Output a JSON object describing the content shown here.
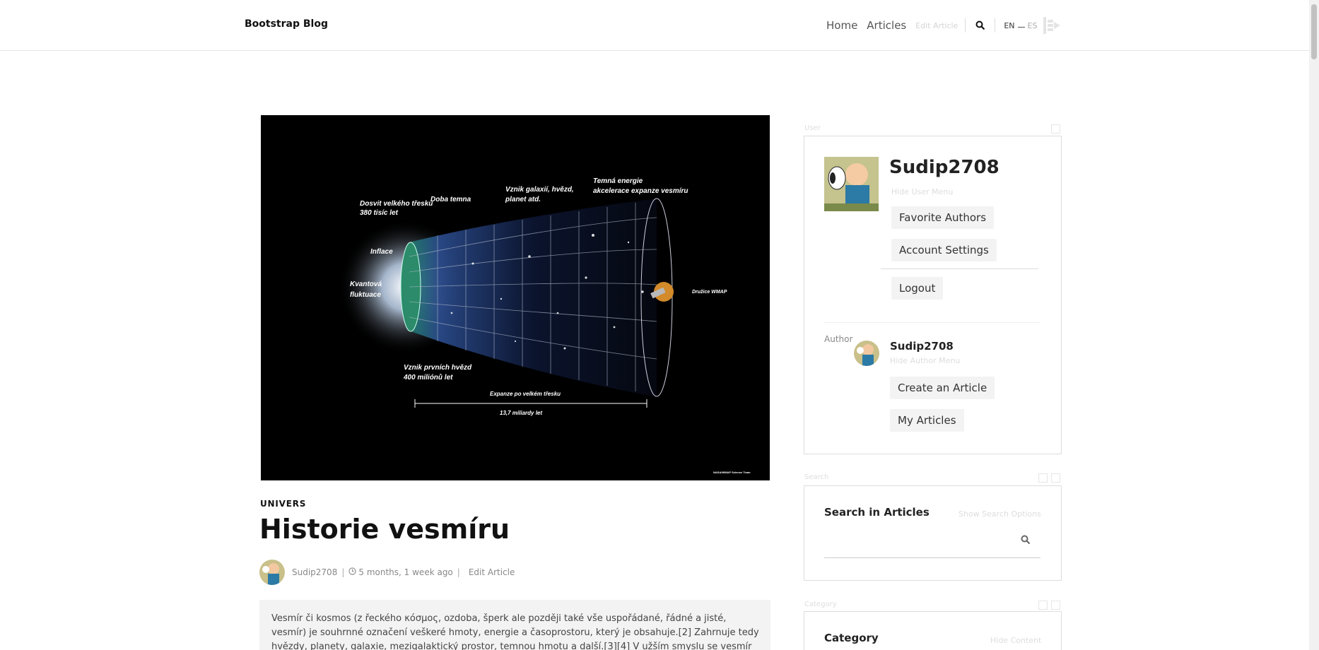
{
  "header": {
    "brand": "Bootstrap Blog",
    "nav": [
      {
        "label": "Home"
      },
      {
        "label": "Articles"
      }
    ],
    "edit_article_ghost": "Edit Article",
    "lang_en": "EN",
    "lang_es": "ES"
  },
  "article": {
    "category": "UNIVERS",
    "title": "Historie vesmíru",
    "author": "Sudip2708",
    "date_ago": "5 months, 1 week ago",
    "edit_link": "Edit Article",
    "excerpt": "Vesmír či kosmos (z řeckého κόσμος, ozdoba, šperk ale později také vše uspořádané, řádné a jisté, vesmír) je souhrnné označení veškeré hmoty, energie a časoprostoru, který je obsahuje.[2] Zahrnuje tedy hvězdy, planety, galaxie, mezigalaktický prostor, temnou hmotu a další.[3][4] V užším smyslu se vesmír také někdy užívá jako",
    "image_labels": {
      "afterglow": "Dosvit velkého třesku\n380 tisíc let",
      "dark_ages": "Doba temna",
      "galaxies": "Vznik galaxií, hvězd,\nplanet atd.",
      "dark_energy": "Temná energie\nakcelerace expanze vesmíru",
      "inflation": "Inflace",
      "quantum": "Kvantová\nfluktuace",
      "first_stars": "Vznik prvních hvězd\n400 miliónů let",
      "expansion": "Expanze po velkém třesku",
      "age": "13,7 miliardy let",
      "wmap": "Družice WMAP",
      "credit": "NASA/WMAP Science Team"
    }
  },
  "sidebar": {
    "user_ghost": "User",
    "username": "Sudip2708",
    "hide_user_menu": "Hide User Menu",
    "favorite_authors": "Favorite Authors",
    "account_settings": "Account Settings",
    "logout": "Logout",
    "author_label": "Author",
    "author_name": "Sudip2708",
    "hide_author_menu": "Hide Author Menu",
    "create_article": "Create an Article",
    "my_articles": "My Articles",
    "search_ghost": "Search",
    "search_title": "Search in Articles",
    "show_search_options": "Show Search Options",
    "category_ghost": "Category",
    "category_title": "Category",
    "hide_content": "Hide Content"
  }
}
